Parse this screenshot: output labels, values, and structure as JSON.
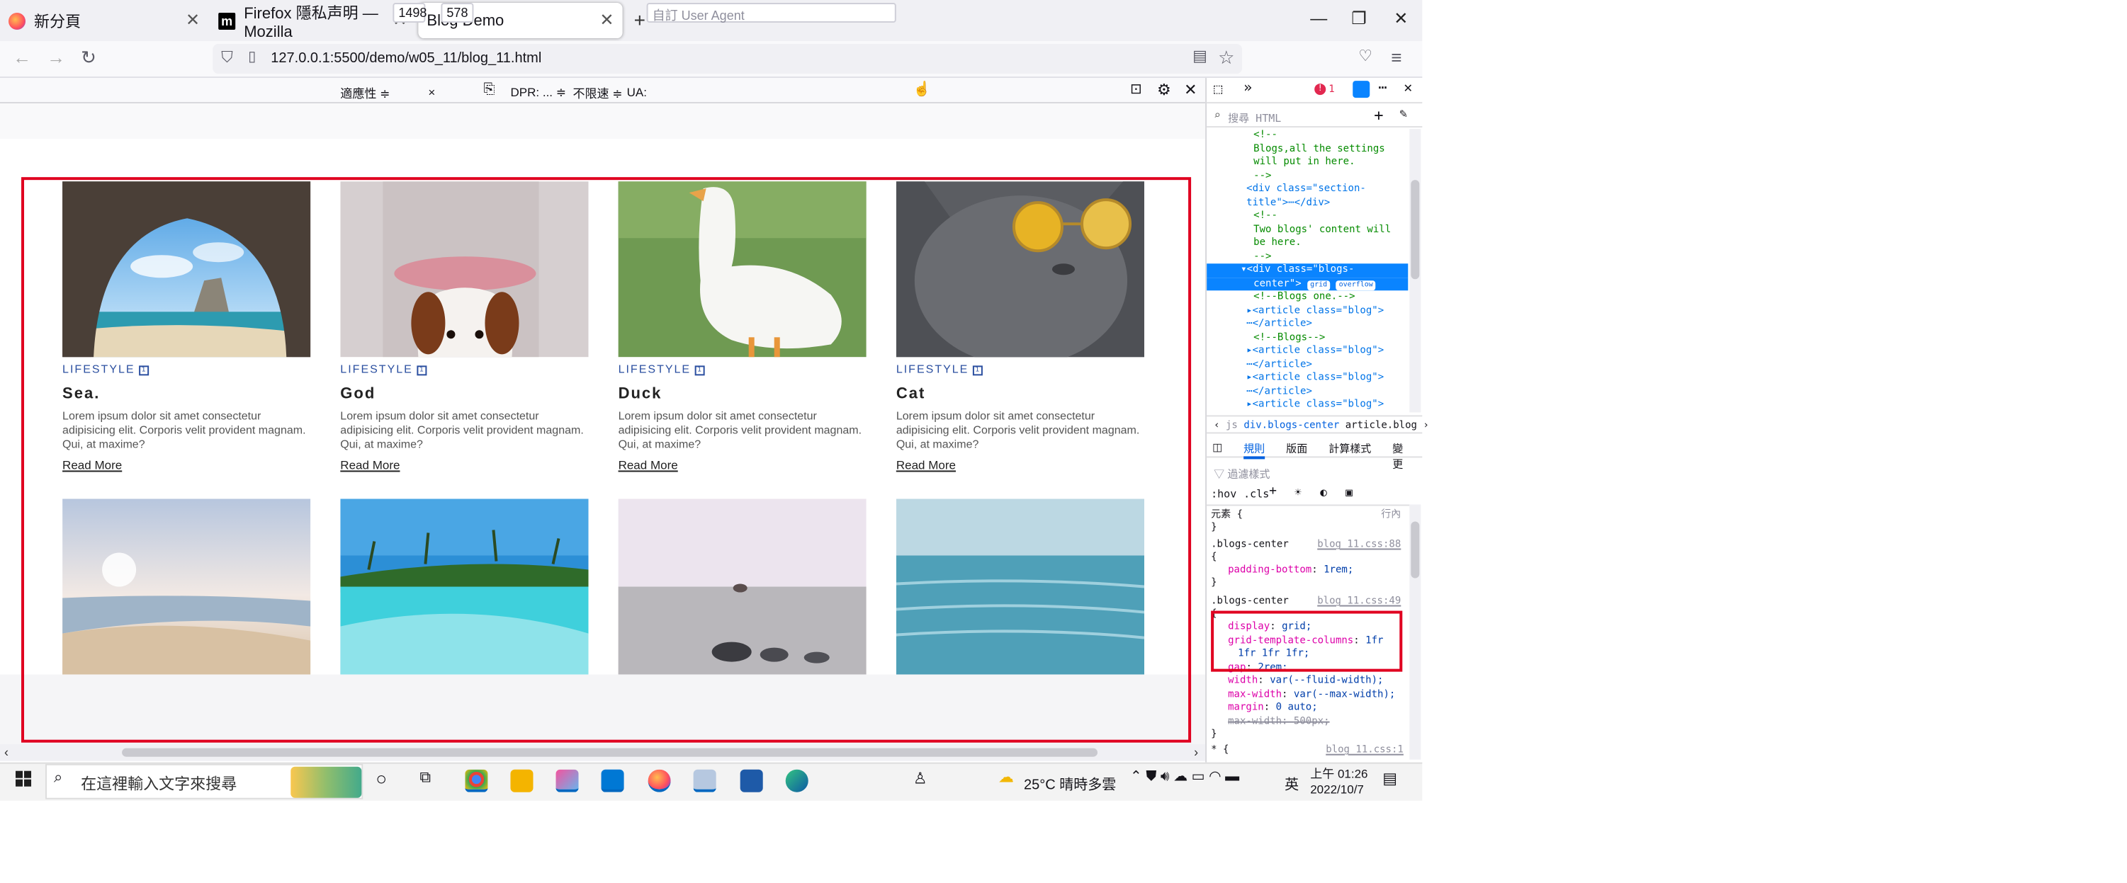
{
  "browser": {
    "tabs": [
      {
        "label": "新分頁"
      },
      {
        "label": "Firefox 隱私声明 — Mozilla"
      },
      {
        "label": "Blog Demo"
      }
    ],
    "new_tab": "+",
    "url": "127.0.0.1:5500/demo/w05_11/blog_11.html"
  },
  "rdm": {
    "device": "適應性 ≑",
    "width": "1498",
    "times": "×",
    "height": "578",
    "dpr": "DPR: ... ≑",
    "throttle": "不限速 ≑",
    "ua_label": "UA:",
    "ua_placeholder": "自訂 User Agent"
  },
  "blogs": [
    {
      "category": "LIFESTYLE",
      "title": "Sea.",
      "desc": "Lorem ipsum dolor sit amet consectetur adipisicing elit. Corporis velit provident magnam. Qui, at maxime?",
      "link": "Read More"
    },
    {
      "category": "LIFESTYLE",
      "title": "God",
      "desc": "Lorem ipsum dolor sit amet consectetur adipisicing elit. Corporis velit provident magnam. Qui, at maxime?",
      "link": "Read More"
    },
    {
      "category": "LIFESTYLE",
      "title": "Duck",
      "desc": "Lorem ipsum dolor sit amet consectetur adipisicing elit. Corporis velit provident magnam. Qui, at maxime?",
      "link": "Read More"
    },
    {
      "category": "LIFESTYLE",
      "title": "Cat",
      "desc": "Lorem ipsum dolor sit amet consectetur adipisicing elit. Corporis velit provident magnam. Qui, at maxime?",
      "link": "Read More"
    }
  ],
  "devtools": {
    "search_placeholder": "搜尋 HTML",
    "error_count": "1",
    "html_lines": [
      {
        "text": "<!--",
        "kind": "comment"
      },
      {
        "text": "Blogs,all the settings",
        "kind": "comment"
      },
      {
        "text": "will put in here.",
        "kind": "comment"
      },
      {
        "text": "-->",
        "kind": "comment"
      },
      {
        "text": "<div class=\"section-",
        "kind": "tag"
      },
      {
        "text": "title\">⋯</div>",
        "kind": "tag"
      },
      {
        "text": "<!--",
        "kind": "comment"
      },
      {
        "text": "Two blogs' content will",
        "kind": "comment"
      },
      {
        "text": "be here.",
        "kind": "comment"
      },
      {
        "text": "-->",
        "kind": "comment"
      }
    ],
    "selected_line1": "▾<div class=\"blogs-",
    "selected_line2": "center\">",
    "badge_grid": "grid",
    "badge_overflow": "overflow",
    "child_lines": [
      {
        "text": "<!--Blogs one.-->",
        "kind": "comment"
      },
      {
        "text": "▸<article class=\"blog\">",
        "kind": "tag"
      },
      {
        "text": "⋯</article>",
        "kind": "tag"
      },
      {
        "text": "<!--Blogs-->",
        "kind": "comment"
      },
      {
        "text": "▸<article class=\"blog\">",
        "kind": "tag"
      },
      {
        "text": "⋯</article>",
        "kind": "tag"
      },
      {
        "text": "▸<article class=\"blog\">",
        "kind": "tag"
      },
      {
        "text": "⋯</article>",
        "kind": "tag"
      },
      {
        "text": "▸<article class=\"blog\">",
        "kind": "tag"
      }
    ],
    "breadcrumb": [
      "js",
      "div.blogs-center",
      "article.blog"
    ],
    "panel_tabs": [
      "規則",
      "版面",
      "計算樣式",
      "變更"
    ],
    "filter_placeholder": "過濾樣式",
    "hov": ":hov",
    "cls": ".cls",
    "element_rule": "元素 {",
    "inline": "行內",
    "close_brace": "}",
    "rules": [
      {
        "selector": ".blogs-center",
        "source": "blog_11.css:88",
        "decls": [
          {
            "prop": "padding-bottom",
            "value": "1rem;"
          }
        ]
      },
      {
        "selector": ".blogs-center",
        "source": "blog_11.css:49",
        "decls": [
          {
            "prop": "display",
            "value": "grid;"
          },
          {
            "prop": "grid-template-columns",
            "value": "1fr"
          },
          {
            "prop": "",
            "value": "1fr 1fr 1fr;"
          },
          {
            "prop": "gap",
            "value": "2rem;"
          },
          {
            "prop": "width",
            "value": "var(--fluid-width);"
          },
          {
            "prop": "max-width",
            "value": "var(--max-width);"
          },
          {
            "prop": "margin",
            "value": "0 auto;"
          },
          {
            "prop": "max-width",
            "value": "500px;"
          }
        ]
      }
    ],
    "last_rule": "* {",
    "last_source": "blog_11.css:1"
  },
  "taskbar": {
    "search_placeholder": "在這裡輸入文字來搜尋",
    "weather": "25°C 晴時多雲",
    "ime": "英",
    "time": "上午 01:26",
    "date": "2022/10/7"
  }
}
